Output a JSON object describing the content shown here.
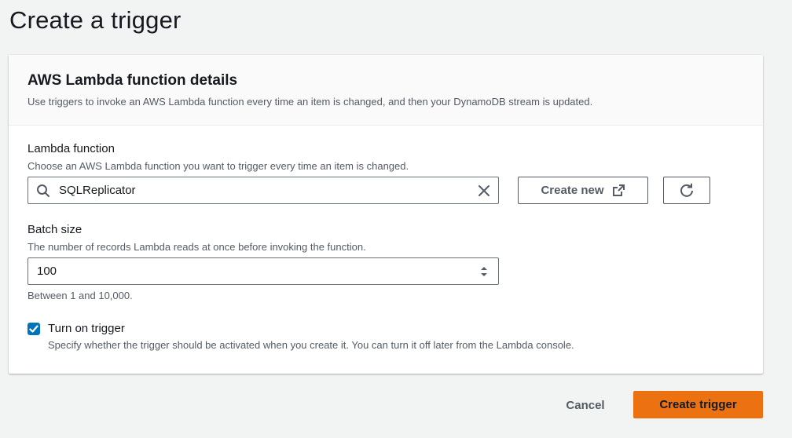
{
  "page": {
    "title": "Create a trigger"
  },
  "panel": {
    "title": "AWS Lambda function details",
    "description": "Use triggers to invoke an AWS Lambda function every time an item is changed, and then your DynamoDB stream is updated."
  },
  "lambda_function": {
    "label": "Lambda function",
    "description": "Choose an AWS Lambda function you want to trigger every time an item is changed.",
    "value": "SQLReplicator",
    "search_icon": "search-icon",
    "clear_icon": "close-icon",
    "create_new_label": "Create new",
    "create_new_icon": "external-link-icon",
    "refresh_icon": "refresh-icon"
  },
  "batch_size": {
    "label": "Batch size",
    "description": "The number of records Lambda reads at once before invoking the function.",
    "value": "100",
    "constraint": "Between 1 and 10,000."
  },
  "trigger_toggle": {
    "checked": true,
    "label": "Turn on trigger",
    "description": "Specify whether the trigger should be activated when you create it. You can turn it off later from the Lambda console."
  },
  "footer": {
    "cancel_label": "Cancel",
    "submit_label": "Create trigger"
  },
  "colors": {
    "primary": "#ec7211",
    "checkbox": "#0073bb",
    "background": "#f2f3f3"
  }
}
